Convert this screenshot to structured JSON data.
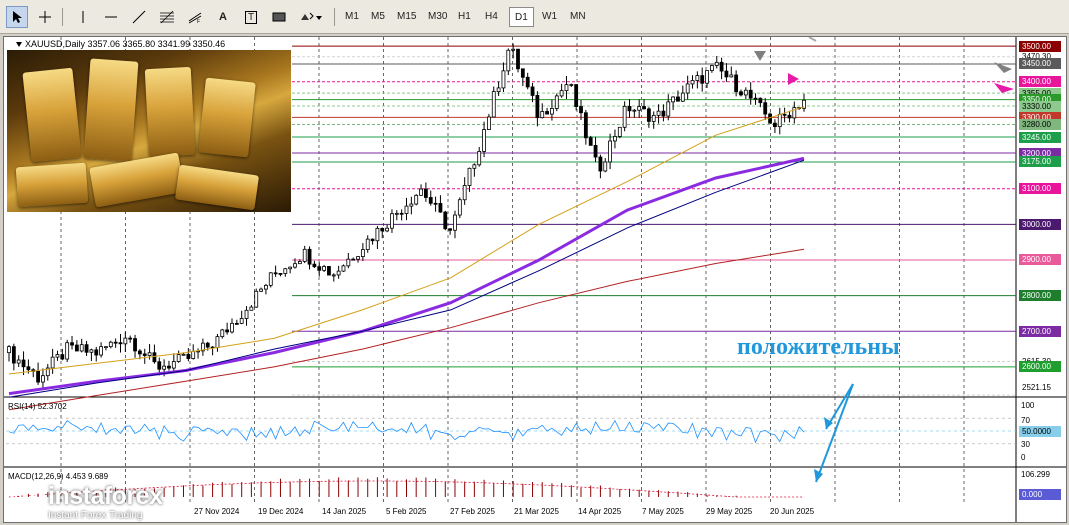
{
  "toolbar": {
    "tools": [
      "cursor",
      "crosshair",
      "vertical-line",
      "horizontal-line",
      "trend-line",
      "fibonacci",
      "text",
      "text-label",
      "rectangle",
      "shapes"
    ],
    "tool_glyphs": {
      "text": "A",
      "text-label": "T"
    },
    "timeframes": [
      "M1",
      "M5",
      "M15",
      "M30",
      "H1",
      "H4",
      "D1",
      "W1",
      "MN"
    ],
    "active_timeframe": "D1"
  },
  "chart": {
    "header": "XAUUSD,Daily  3357.06 3365.80 3341.99 3350.46",
    "caption": "положительны",
    "price_labels": [
      {
        "text": "3500.00",
        "bg": "#8b0000",
        "fg": "#ffffff",
        "y": 3500
      },
      {
        "text": "3470.30",
        "bg": "",
        "fg": "#000000",
        "y": 3470
      },
      {
        "text": "3450.00",
        "bg": "#5a5a5a",
        "fg": "#ffffff",
        "y": 3450
      },
      {
        "text": "3400.00",
        "bg": "#e8149a",
        "fg": "#ffffff",
        "y": 3400
      },
      {
        "text": "3355.00",
        "bg": "#8ec98e",
        "fg": "#000000",
        "y": 3368
      },
      {
        "text": "3350.00",
        "bg": "#2a9a2a",
        "fg": "#ffffff",
        "y": 3350
      },
      {
        "text": "3330.00",
        "bg": "#8ec98e",
        "fg": "#000000",
        "y": 3332
      },
      {
        "text": "3300.00",
        "bg": "#c0392b",
        "fg": "#ffffff",
        "y": 3300
      },
      {
        "text": "3280.00",
        "bg": "#7fb77f",
        "fg": "#000000",
        "y": 3280
      },
      {
        "text": "3245.00",
        "bg": "#1e9e4a",
        "fg": "#ffffff",
        "y": 3245
      },
      {
        "text": "3200.00",
        "bg": "#7b2ca3",
        "fg": "#ffffff",
        "y": 3200
      },
      {
        "text": "3175.00",
        "bg": "#1e9e4a",
        "fg": "#ffffff",
        "y": 3175
      },
      {
        "text": "3100.00",
        "bg": "#e8149a",
        "fg": "#ffffff",
        "y": 3100
      },
      {
        "text": "3000.00",
        "bg": "#4b1a6e",
        "fg": "#ffffff",
        "y": 3000
      },
      {
        "text": "2900.00",
        "bg": "#e85a9a",
        "fg": "#ffffff",
        "y": 2900
      },
      {
        "text": "2800.00",
        "bg": "#1e7e2e",
        "fg": "#ffffff",
        "y": 2800
      },
      {
        "text": "2700.00",
        "bg": "#7b2ca3",
        "fg": "#ffffff",
        "y": 2700
      },
      {
        "text": "2615.30",
        "bg": "",
        "fg": "#000000",
        "y": 2615
      },
      {
        "text": "2600.00",
        "bg": "#1e9e2e",
        "fg": "#ffffff",
        "y": 2600
      },
      {
        "text": "2521.15",
        "bg": "",
        "fg": "#000000",
        "y": 2521
      }
    ],
    "dates": [
      "27 Nov 2024",
      "19 Dec 2024",
      "14 Jan 2025",
      "5 Feb 2025",
      "27 Feb 2025",
      "21 Mar 2025",
      "14 Apr 2025",
      "7 May 2025",
      "29 May 2025",
      "20 Jun 2025"
    ]
  },
  "rsi": {
    "title": "RSI(14) 52.3702",
    "scale": [
      "100",
      "70",
      "30",
      "0"
    ],
    "level_label": "50.0000"
  },
  "macd": {
    "title": "MACD(12,26,9) 4.453 9.689",
    "scale_top": "106.299",
    "zero_label": "0.000"
  },
  "branding": {
    "name": "instaforex",
    "tagline": "Instant Forex Trading"
  },
  "chart_data": {
    "type": "candlestick",
    "symbol": "XAUUSD",
    "timeframe": "Daily",
    "ylim": [
      2521.15,
      3520
    ],
    "close_path": [
      {
        "date": "2024-11-05",
        "close": 2640
      },
      {
        "date": "2024-11-14",
        "close": 2570
      },
      {
        "date": "2024-11-27",
        "close": 2650
      },
      {
        "date": "2024-12-05",
        "close": 2640
      },
      {
        "date": "2024-12-12",
        "close": 2690
      },
      {
        "date": "2024-12-19",
        "close": 2600
      },
      {
        "date": "2024-12-30",
        "close": 2620
      },
      {
        "date": "2025-01-14",
        "close": 2670
      },
      {
        "date": "2025-01-28",
        "close": 2760
      },
      {
        "date": "2025-02-05",
        "close": 2860
      },
      {
        "date": "2025-02-14",
        "close": 2920
      },
      {
        "date": "2025-02-27",
        "close": 2860
      },
      {
        "date": "2025-03-10",
        "close": 2940
      },
      {
        "date": "2025-03-21",
        "close": 3020
      },
      {
        "date": "2025-04-01",
        "close": 3100
      },
      {
        "date": "2025-04-08",
        "close": 2980
      },
      {
        "date": "2025-04-14",
        "close": 3230
      },
      {
        "date": "2025-04-22",
        "close": 3500
      },
      {
        "date": "2025-04-30",
        "close": 3300
      },
      {
        "date": "2025-05-07",
        "close": 3400
      },
      {
        "date": "2025-05-15",
        "close": 3150
      },
      {
        "date": "2025-05-22",
        "close": 3330
      },
      {
        "date": "2025-05-29",
        "close": 3300
      },
      {
        "date": "2025-06-06",
        "close": 3380
      },
      {
        "date": "2025-06-13",
        "close": 3440
      },
      {
        "date": "2025-06-20",
        "close": 3370
      },
      {
        "date": "2025-06-26",
        "close": 3280
      },
      {
        "date": "2025-07-01",
        "close": 3350
      }
    ],
    "moving_averages": [
      {
        "color": "#d4a017",
        "points": [
          2580,
          2610,
          2640,
          2680,
          2760,
          2850,
          3000,
          3120,
          3250,
          3330
        ]
      },
      {
        "color": "#8a2be2",
        "points": [
          2525,
          2560,
          2590,
          2640,
          2700,
          2780,
          2900,
          3040,
          3130,
          3185
        ]
      },
      {
        "color": "#000080",
        "points": [
          2515,
          2555,
          2590,
          2650,
          2700,
          2760,
          2870,
          2990,
          3090,
          3180
        ]
      },
      {
        "color": "#b22222",
        "points": [
          2480,
          2520,
          2560,
          2600,
          2650,
          2710,
          2780,
          2840,
          2890,
          2930
        ]
      }
    ],
    "rsi": {
      "ylim": [
        0,
        100
      ],
      "levels": [
        70,
        50,
        30
      ],
      "last": 52.37
    },
    "macd": {
      "last_main": 4.453,
      "last_signal": 9.689
    }
  }
}
